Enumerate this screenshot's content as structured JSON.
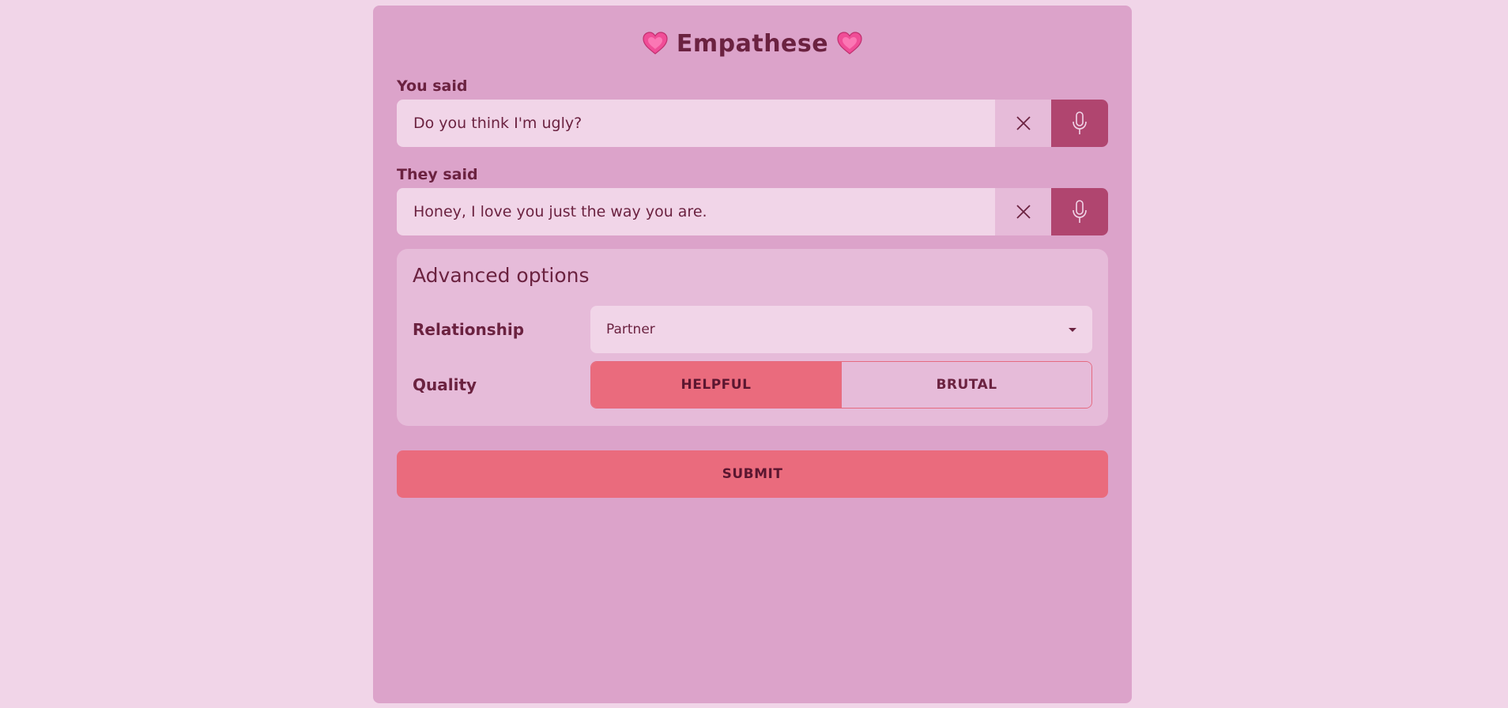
{
  "app": {
    "title": "Empathese",
    "heart_icon": "heart-icon"
  },
  "you_said": {
    "label": "You said",
    "value": "Do you think I'm ugly?"
  },
  "they_said": {
    "label": "They said",
    "value": "Honey, I love you just the way you are."
  },
  "advanced": {
    "title": "Advanced options",
    "relationship": {
      "label": "Relationship",
      "selected": "Partner"
    },
    "quality": {
      "label": "Quality",
      "options": [
        "HELPFUL",
        "BRUTAL"
      ],
      "selected": "HELPFUL"
    }
  },
  "submit_label": "SUBMIT",
  "colors": {
    "page_bg": "#f1d5e8",
    "card_bg": "#dca3ca",
    "accent": "#ea6b7d",
    "mic": "#b0456f",
    "text": "#6b2240"
  }
}
